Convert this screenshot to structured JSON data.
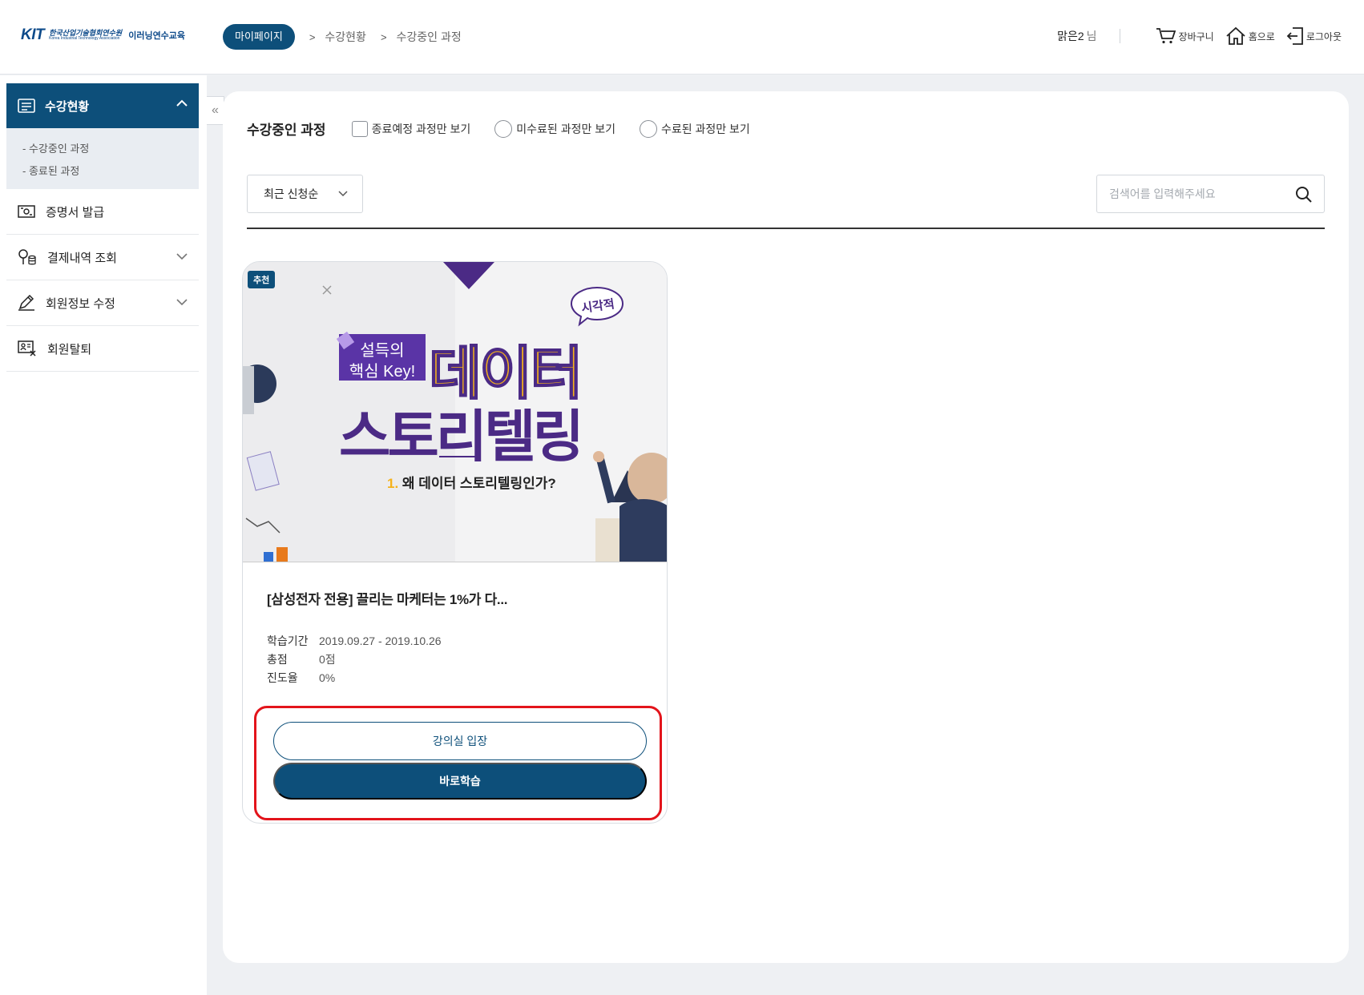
{
  "header": {
    "logo_mark": "KIT",
    "logo_ko": "한국산업기술협회연수원",
    "logo_en": "Korea Industrial Technology Association",
    "logo_sub": "이러닝연수교육",
    "breadcrumb": [
      "마이페이지",
      "수강현황",
      "수강중인 과정"
    ],
    "user_name": "맑은2",
    "user_suffix": "님",
    "links": [
      {
        "label": "장바구니",
        "icon": "cart-icon"
      },
      {
        "label": "홈으로",
        "icon": "home-icon"
      },
      {
        "label": "로그아웃",
        "icon": "logout-icon"
      }
    ]
  },
  "sidebar": {
    "active": {
      "label": "수강현황",
      "icon": "list-icon"
    },
    "sub_items": [
      "- 수강중인 과정",
      "- 종료된 과정"
    ],
    "items": [
      {
        "label": "증명서 발급",
        "icon": "certificate-icon"
      },
      {
        "label": "결제내역 조회",
        "icon": "payment-icon"
      },
      {
        "label": "회원정보 수정",
        "icon": "pencil-icon"
      },
      {
        "label": "회원탈퇴",
        "icon": "withdraw-icon"
      }
    ],
    "collapse_glyph": "«"
  },
  "main": {
    "title": "수강중인 과정",
    "filters": [
      "종료예정 과정만 보기",
      "미수료된 과정만 보기",
      "수료된 과정만 보기"
    ],
    "sort_value": "최근 신청순",
    "search_placeholder": "검색어를 입력해주세요"
  },
  "card": {
    "badge": "추천",
    "thumb": {
      "tag": "시각적",
      "sub1": "설득의",
      "sub2": "핵심 Key!",
      "big1": "데이터",
      "big2": "스토리텔링",
      "episode_num": "1.",
      "episode": "왜 데이터 스토리텔링인가?"
    },
    "title": "[삼성전자 전용] 끌리는 마케터는 1%가 다...",
    "meta": [
      {
        "label": "학습기간",
        "value": "2019.09.27 - 2019.10.26"
      },
      {
        "label": "총점",
        "value": "0점"
      },
      {
        "label": "진도율",
        "value": "0%"
      }
    ],
    "enter_button": "강의실 입장",
    "study_button": "바로학습"
  },
  "colors": {
    "primary": "#0d4f7a",
    "highlight": "#e3141b",
    "accent_yellow": "#f5b21b",
    "accent_purple": "#4b2a85"
  }
}
